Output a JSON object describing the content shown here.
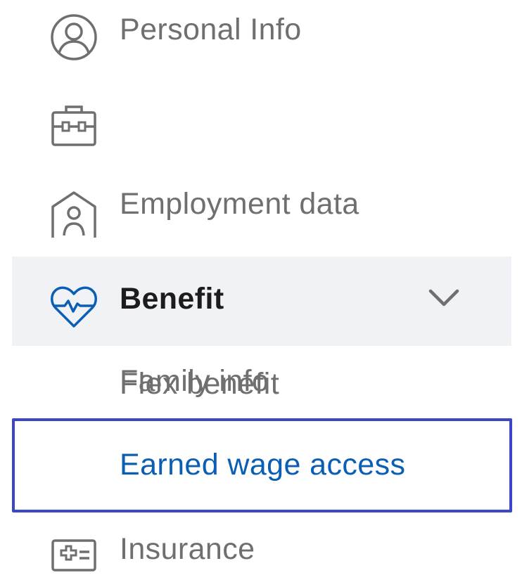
{
  "nav": {
    "items": [
      {
        "label": "Personal Info",
        "icon": "user-circle-icon"
      },
      {
        "label": "Employment data",
        "icon": "briefcase-icon"
      },
      {
        "label": "Family info",
        "icon": "home-user-icon"
      },
      {
        "label": "Benefit",
        "icon": "heart-pulse-icon",
        "expanded": true,
        "children": [
          {
            "label": "Flex benefit"
          },
          {
            "label": "Earned wage access",
            "selected": true
          }
        ]
      },
      {
        "label": "Insurance",
        "icon": "medical-card-icon"
      }
    ]
  },
  "colors": {
    "text_muted": "#6f6f6f",
    "text_active": "#1c1c1c",
    "accent_blue": "#0a5fb4",
    "active_bg": "#f1f2f5",
    "focus_border": "#3c46c8",
    "icon_gray": "#6f6f6f"
  }
}
